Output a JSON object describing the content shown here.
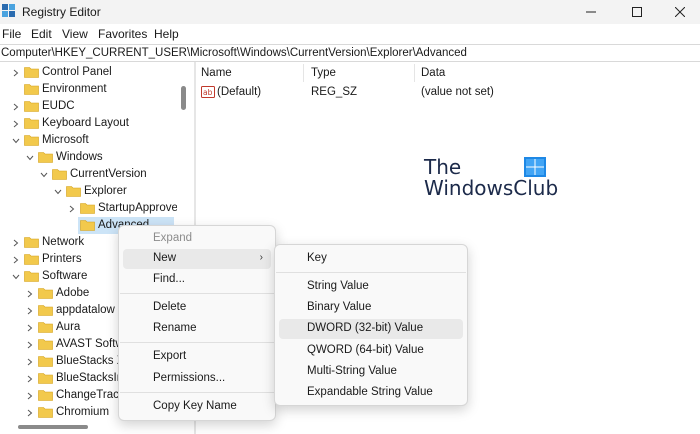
{
  "window": {
    "title": "Registry Editor"
  },
  "menubar": {
    "items": [
      "File",
      "Edit",
      "View",
      "Favorites",
      "Help"
    ]
  },
  "address": {
    "path": "Computer\\HKEY_CURRENT_USER\\Microsoft\\Windows\\CurrentVersion\\Explorer\\Advanced"
  },
  "tree": {
    "items": [
      {
        "label": "Control Panel",
        "expanded": false
      },
      {
        "label": "Environment",
        "expanded": null
      },
      {
        "label": "EUDC",
        "expanded": false
      },
      {
        "label": "Keyboard Layout",
        "expanded": false
      },
      {
        "label": "Microsoft",
        "expanded": true
      },
      {
        "label": "Windows",
        "expanded": true
      },
      {
        "label": "CurrentVersion",
        "expanded": true
      },
      {
        "label": "Explorer",
        "expanded": true
      },
      {
        "label": "StartupApprove",
        "expanded": false
      },
      {
        "label": "Advanced",
        "expanded": null,
        "selected": true
      },
      {
        "label": "Network",
        "expanded": false
      },
      {
        "label": "Printers",
        "expanded": false
      },
      {
        "label": "Software",
        "expanded": true
      },
      {
        "label": "Adobe",
        "expanded": false
      },
      {
        "label": "appdatalow",
        "expanded": false
      },
      {
        "label": "Aura",
        "expanded": false
      },
      {
        "label": "AVAST Softw",
        "expanded": false
      },
      {
        "label": "BlueStacks X",
        "expanded": false
      },
      {
        "label": "BlueStacksIns",
        "expanded": false
      },
      {
        "label": "ChangeTracke",
        "expanded": false
      },
      {
        "label": "Chromium",
        "expanded": false
      }
    ]
  },
  "list": {
    "columns": [
      "Name",
      "Type",
      "Data"
    ],
    "rows": [
      {
        "name": "(Default)",
        "type": "REG_SZ",
        "data": "(value not set)"
      }
    ]
  },
  "watermark": {
    "line1": "The",
    "line2": "WindowsClub"
  },
  "context_menu": {
    "expand": "Expand",
    "new": "New",
    "find": "Find...",
    "delete": "Delete",
    "rename": "Rename",
    "export": "Export",
    "permissions": "Permissions...",
    "copy_key_name": "Copy Key Name"
  },
  "submenu": {
    "key": "Key",
    "string_value": "String Value",
    "binary_value": "Binary Value",
    "dword_value": "DWORD (32-bit) Value",
    "qword_value": "QWORD (64-bit) Value",
    "multi_string_value": "Multi-String Value",
    "expandable_string_value": "Expandable String Value"
  },
  "colors": {
    "folder": "#f2c94c",
    "selection": "#cce4f7",
    "hover": "#e9e9e9"
  }
}
